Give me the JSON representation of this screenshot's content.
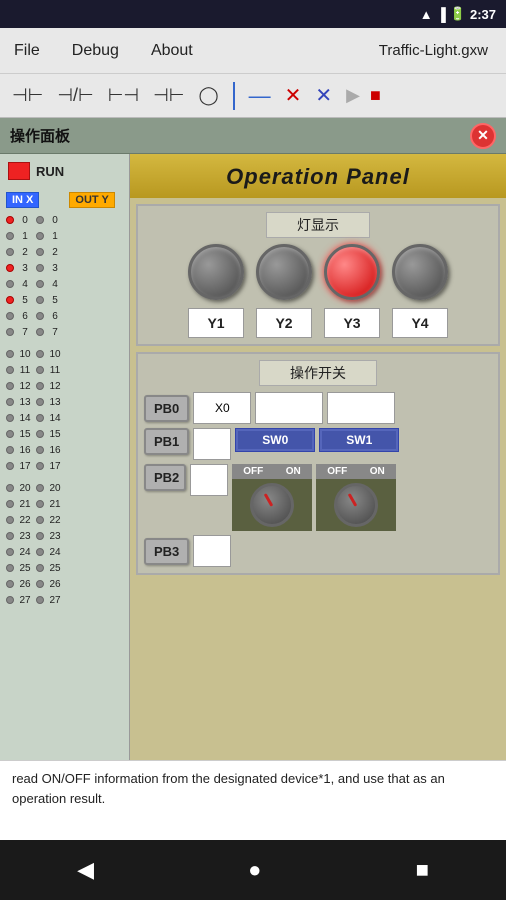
{
  "statusBar": {
    "time": "2:37",
    "icons": [
      "wifi",
      "signal",
      "battery"
    ]
  },
  "menuBar": {
    "file": "File",
    "debug": "Debug",
    "about": "About",
    "filename": "Traffic-Light.gxw"
  },
  "toolbar": {
    "icons": [
      "contact-no",
      "contact-nc",
      "contact-pos",
      "contact-neg",
      "coil",
      "separator",
      "line",
      "xmark",
      "xmark2",
      "play",
      "stop"
    ]
  },
  "window": {
    "title": "操作面板",
    "closeBtn": "✕"
  },
  "opPanel": {
    "header": "Operation Panel",
    "lightSection": {
      "label": "灯显示",
      "lights": [
        {
          "id": "Y1",
          "active": false
        },
        {
          "id": "Y2",
          "active": false
        },
        {
          "id": "Y3",
          "active": true
        },
        {
          "id": "Y4",
          "active": false
        }
      ]
    },
    "switchSection": {
      "label": "操作开关",
      "rows": [
        {
          "pb": "PB0",
          "input": "X0",
          "val1": "",
          "val2": ""
        },
        {
          "pb": "PB1",
          "input": "",
          "sw": "SW0",
          "swState": "OFF"
        },
        {
          "pb": "PB2",
          "input": "",
          "sw": "",
          "swState": ""
        },
        {
          "pb": "PB3",
          "input": "",
          "sw": "SW1",
          "swState": "OFF"
        }
      ],
      "sw0Label": "SW0",
      "sw1Label": "SW1",
      "offLabel": "OFF",
      "onLabel": "ON"
    }
  },
  "sidebar": {
    "runLabel": "RUN",
    "inLabel": "IN X",
    "outLabel": "OUT Y",
    "rows": [
      {
        "num": "0",
        "inActive": true,
        "outActive": false
      },
      {
        "num": "1",
        "inActive": false,
        "outActive": false
      },
      {
        "num": "2",
        "inActive": false,
        "outActive": false
      },
      {
        "num": "3",
        "inActive": true,
        "outActive": false
      },
      {
        "num": "4",
        "inActive": false,
        "outActive": false
      },
      {
        "num": "5",
        "inActive": true,
        "outActive": false
      },
      {
        "num": "6",
        "inActive": false,
        "outActive": false
      },
      {
        "num": "7",
        "inActive": false,
        "outActive": false
      }
    ],
    "rows2": [
      {
        "num": "10",
        "inActive": false,
        "outActive": false
      },
      {
        "num": "11",
        "inActive": false,
        "outActive": false
      },
      {
        "num": "12",
        "inActive": false,
        "outActive": false
      },
      {
        "num": "13",
        "inActive": false,
        "outActive": false
      },
      {
        "num": "14",
        "inActive": false,
        "outActive": false
      },
      {
        "num": "15",
        "inActive": false,
        "outActive": false
      },
      {
        "num": "16",
        "inActive": false,
        "outActive": false
      },
      {
        "num": "17",
        "inActive": false,
        "outActive": false
      }
    ],
    "rows3": [
      {
        "num": "20",
        "inActive": false,
        "outActive": false
      },
      {
        "num": "21",
        "inActive": false,
        "outActive": false
      },
      {
        "num": "22",
        "inActive": false,
        "outActive": false
      },
      {
        "num": "23",
        "inActive": false,
        "outActive": false
      },
      {
        "num": "24",
        "inActive": false,
        "outActive": false
      },
      {
        "num": "25",
        "inActive": false,
        "outActive": false
      },
      {
        "num": "26",
        "inActive": false,
        "outActive": false
      },
      {
        "num": "27",
        "inActive": false,
        "outActive": false
      }
    ]
  },
  "bottomText": "read ON/OFF information from the designated device*1, and use that as an operation result.",
  "bottomNav": {
    "back": "◀",
    "home": "●",
    "square": "■"
  }
}
